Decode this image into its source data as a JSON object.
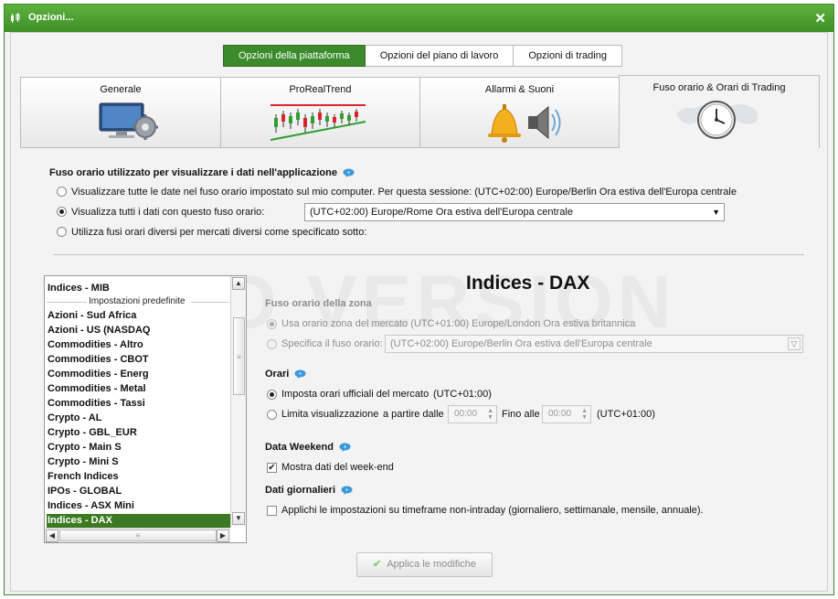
{
  "window": {
    "title": "Opzioni...",
    "close_glyph": "✕"
  },
  "top_tabs": [
    {
      "label": "Opzioni della piattaforma",
      "active": true
    },
    {
      "label": "Opzioni del piano di lavoro",
      "active": false
    },
    {
      "label": "Opzioni di trading",
      "active": false
    }
  ],
  "icon_tabs": [
    {
      "label": "Generale",
      "icon": "monitor-gear-icon",
      "active": false
    },
    {
      "label": "ProRealTrend",
      "icon": "trend-chart-icon",
      "active": false
    },
    {
      "label": "Allarmi & Suoni",
      "icon": "bell-speaker-icon",
      "active": false
    },
    {
      "label": "Fuso orario & Orari di Trading",
      "icon": "clock-world-icon",
      "active": true
    }
  ],
  "timezone_section": {
    "title": "Fuso orario utilizzato per visualizzare i dati nell'applicazione",
    "options": [
      {
        "label": "Visualizzare tutte le date nel fuso orario impostato sul mio computer. Per questa sessione: (UTC+02:00) Europe/Berlin Ora estiva dell'Europa centrale",
        "selected": false
      },
      {
        "label": "Visualizza tutti i dati con questo fuso orario:",
        "selected": true
      },
      {
        "label": "Utilizza fusi orari diversi per mercati diversi come specificato sotto:",
        "selected": false
      }
    ],
    "selected_timezone": "(UTC+02:00) Europe/Rome Ora estiva dell'Europa centrale"
  },
  "watermark": "DEMO VERSION",
  "market_list": {
    "items": [
      {
        "label": "Indices - MIB",
        "selected": false
      },
      {
        "label": "Azioni - Sud Africa",
        "selected": false
      },
      {
        "label": "Azioni - US (NASDAQ",
        "selected": false
      },
      {
        "label": "Commodities - Altro",
        "selected": false
      },
      {
        "label": "Commodities - CBOT",
        "selected": false
      },
      {
        "label": "Commodities - Energ",
        "selected": false
      },
      {
        "label": "Commodities - Metal",
        "selected": false
      },
      {
        "label": "Commodities - Tassi",
        "selected": false
      },
      {
        "label": "Crypto - AL",
        "selected": false
      },
      {
        "label": "Crypto - GBL_EUR",
        "selected": false
      },
      {
        "label": "Crypto - Main S",
        "selected": false
      },
      {
        "label": "Crypto - Mini S",
        "selected": false
      },
      {
        "label": "French Indices",
        "selected": false
      },
      {
        "label": "IPOs - GLOBAL",
        "selected": false
      },
      {
        "label": "Indices - ASX Mini",
        "selected": false
      },
      {
        "label": "Indices - DAX",
        "selected": true
      }
    ],
    "group_label": "Impostazioni predefinite"
  },
  "detail": {
    "market_title": "Indices - DAX",
    "zone_section": {
      "title": "Fuso orario della zona",
      "use_market_label": "Usa orario zona del mercato (UTC+01:00) Europe/London Ora estiva britannica",
      "specify_label": "Specifica il fuso orario:",
      "specify_value": "(UTC+02:00) Europe/Berlin Ora estiva dell'Europa centrale"
    },
    "hours_section": {
      "title": "Orari",
      "official_label": "Imposta orari ufficiali del mercato",
      "official_tz": "(UTC+01:00)",
      "limit_label": "Limita visualizzazione",
      "from_label": "a partire dalle",
      "from_value": "00:00",
      "to_label": "Fino alle",
      "to_value": "00:00",
      "limit_tz": "(UTC+01:00)"
    },
    "weekend_section": {
      "title": "Data Weekend",
      "show_weekend_label": "Mostra dati del week-end",
      "checked": true
    },
    "daily_section": {
      "title": "Dati giornalieri",
      "apply_label": "Applichi le impostazioni su timeframe non-intraday (giornaliero, settimanale, mensile, annuale).",
      "checked": false
    },
    "apply_button": "Applica le modifiche"
  },
  "colors": {
    "accent_green": "#3b8a2c",
    "selected_row": "#3b7a22",
    "info_blue": "#3a9ad9"
  }
}
